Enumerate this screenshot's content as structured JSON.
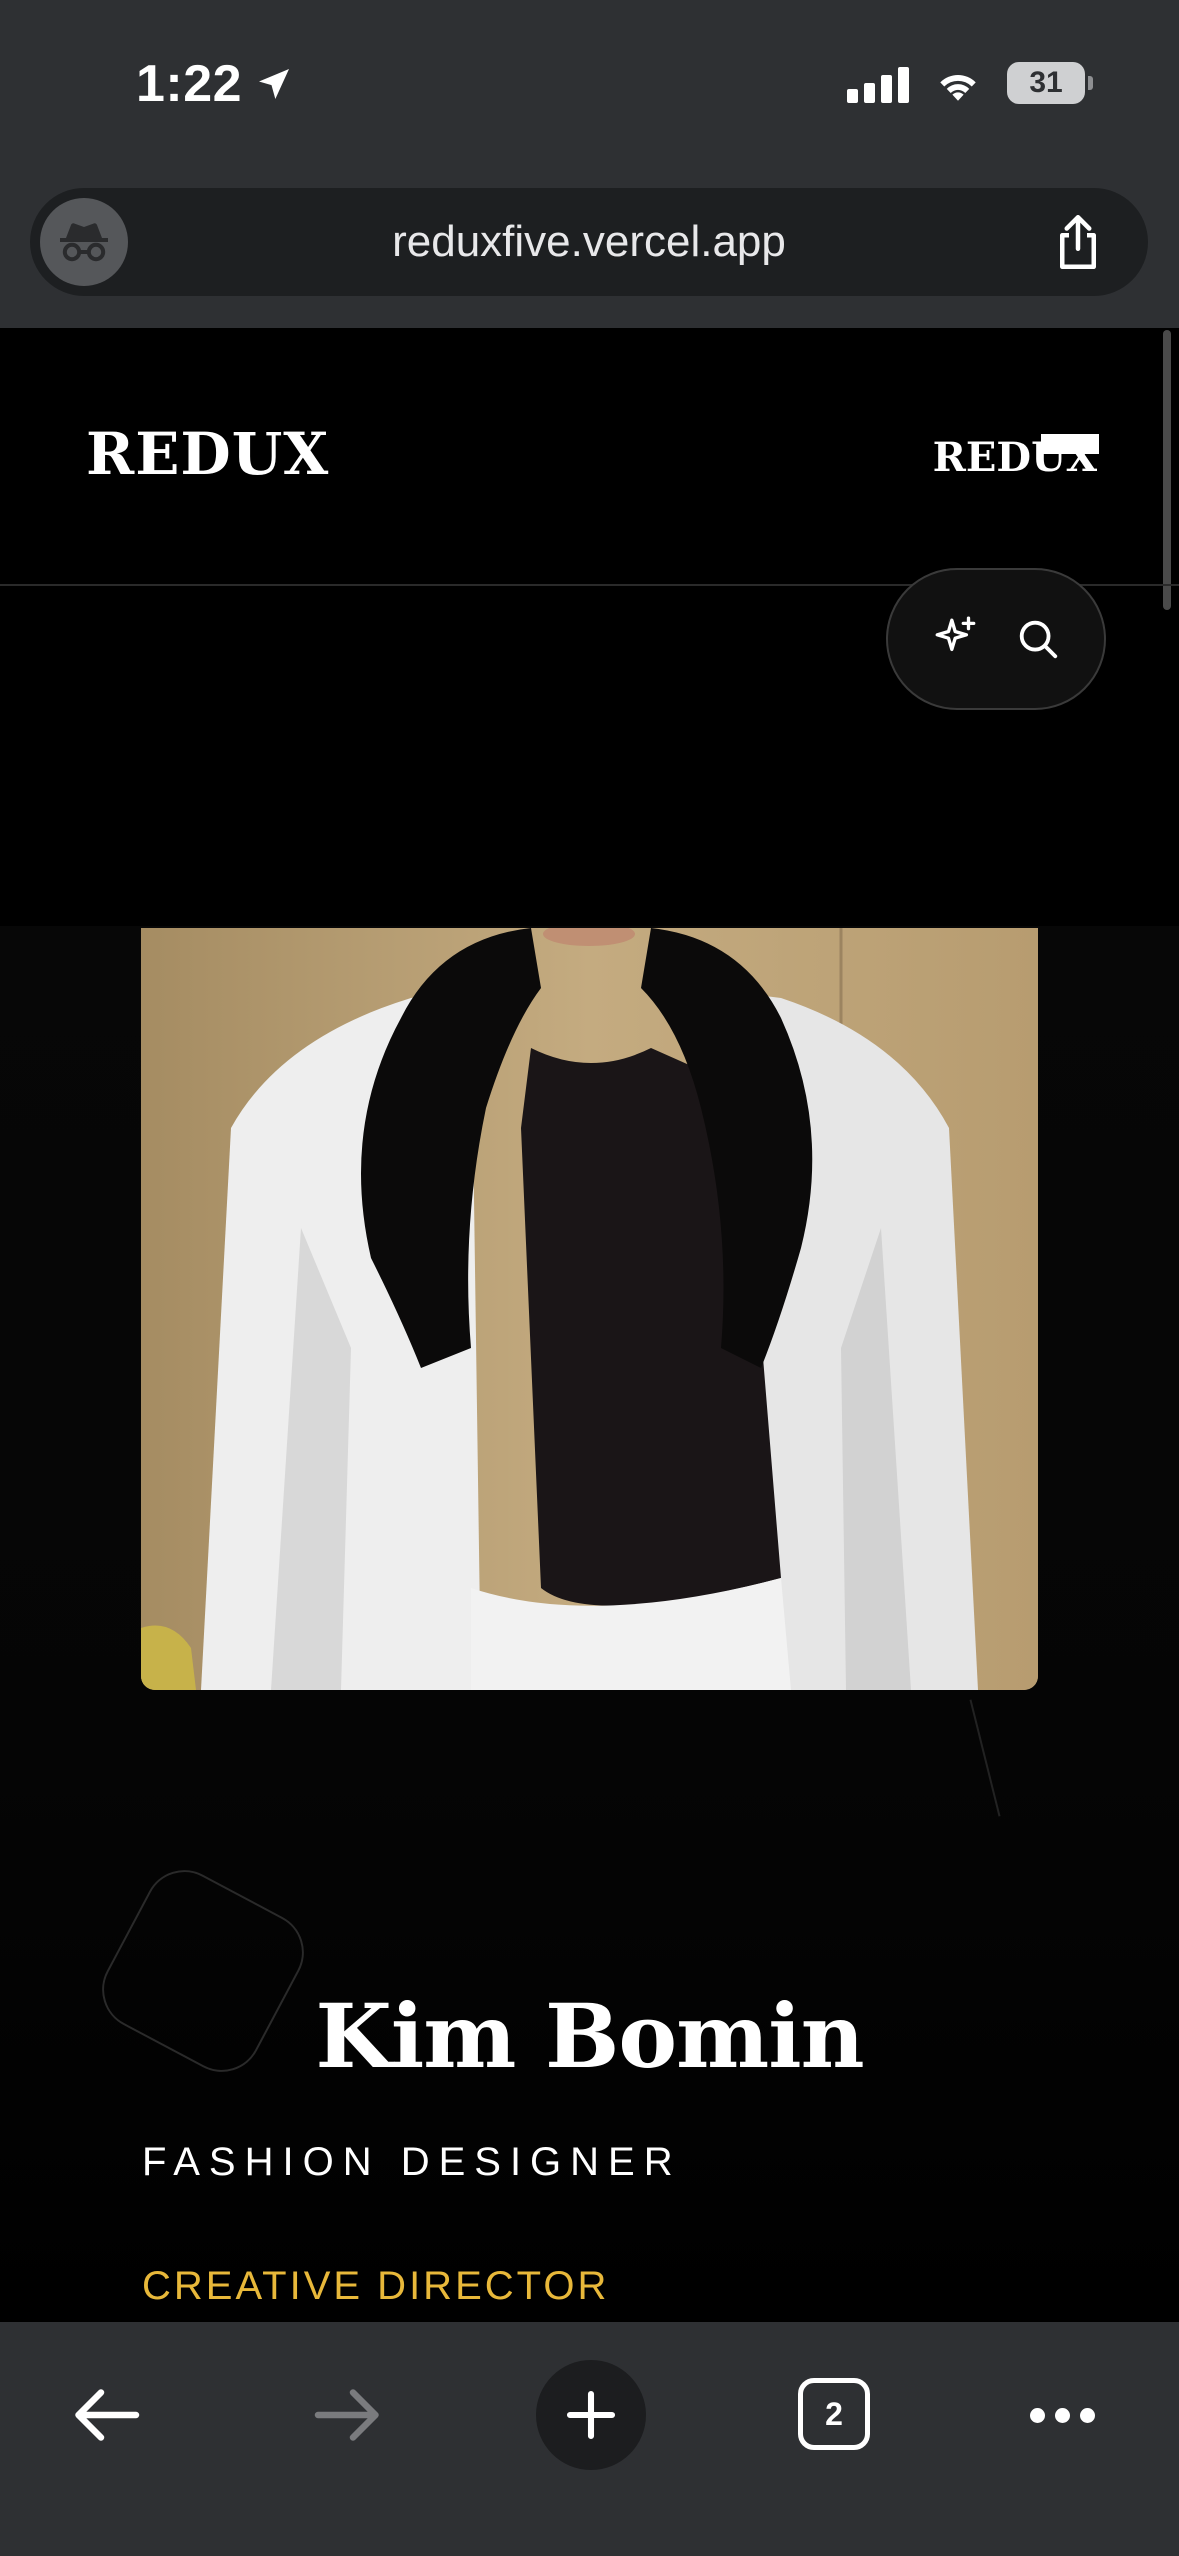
{
  "status_bar": {
    "time": "1:22",
    "battery": "31"
  },
  "browser": {
    "url": "reduxfive.vercel.app",
    "tab_count": "2"
  },
  "site": {
    "logo_left": "REDUX",
    "logo_right": "REDUX"
  },
  "profile": {
    "name": "Kim Bomin",
    "role": "FASHION DESIGNER",
    "subrole": "CREATIVE DIRECTOR"
  },
  "colors": {
    "accent": "#e8b83a",
    "chrome": "#2e3033",
    "page_bg": "#000000"
  },
  "icons": {
    "location": "location-arrow-icon",
    "incognito": "incognito-icon",
    "share": "share-icon",
    "sparkle": "sparkle-icon",
    "search": "search-icon",
    "back": "back-arrow-icon",
    "forward": "forward-arrow-icon",
    "new_tab": "plus-icon",
    "more": "more-icon"
  }
}
